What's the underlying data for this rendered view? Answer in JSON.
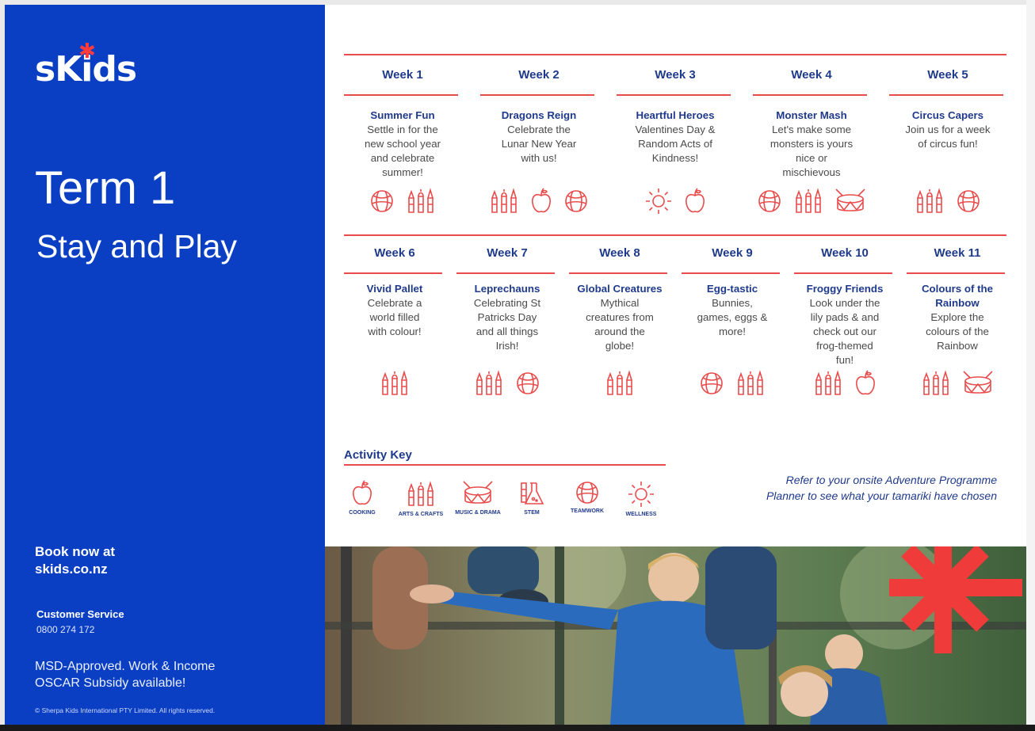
{
  "sidebar": {
    "logo": "sKids",
    "term_title": "Term 1",
    "term_subtitle": "Stay and Play",
    "book_line1": "Book now at",
    "book_line2": "skids.co.nz",
    "customer_service_title": "Customer Service",
    "customer_service_phone": "0800 274 172",
    "msd_line1": "MSD-Approved. Work & Income",
    "msd_line2": "OSCAR Subsidy available!",
    "copyright": "© Sherpa Kids International PTY Limited. All rights reserved."
  },
  "weeks": [
    {
      "label": "Week 1",
      "theme": "Summer Fun",
      "desc": [
        "Settle in for the",
        "new school year",
        "and celebrate",
        "summer!"
      ],
      "icons": [
        "teamwork",
        "arts"
      ]
    },
    {
      "label": "Week 2",
      "theme": "Dragons Reign",
      "desc": [
        "Celebrate the",
        "Lunar New Year",
        "with us!"
      ],
      "icons": [
        "arts",
        "cooking",
        "teamwork"
      ]
    },
    {
      "label": "Week 3",
      "theme": "Heartful Heroes",
      "desc": [
        "Valentines Day &",
        "Random Acts of",
        "Kindness!"
      ],
      "icons": [
        "wellness",
        "cooking"
      ]
    },
    {
      "label": "Week 4",
      "theme": "Monster Mash",
      "desc": [
        "Let's make some",
        "monsters is yours",
        "nice or",
        "mischievous"
      ],
      "icons": [
        "teamwork",
        "arts",
        "music"
      ]
    },
    {
      "label": "Week 5",
      "theme": "Circus Capers",
      "desc": [
        "Join us for a week",
        "of circus fun!"
      ],
      "icons": [
        "arts",
        "teamwork"
      ]
    },
    {
      "label": "Week 6",
      "theme": "Vivid Pallet",
      "desc": [
        "Celebrate a",
        "world filled",
        "with colour!"
      ],
      "icons": [
        "arts"
      ]
    },
    {
      "label": "Week 7",
      "theme": "Leprechauns",
      "desc": [
        "Celebrating St",
        "Patricks Day",
        "and all things",
        "Irish!"
      ],
      "icons": [
        "arts",
        "teamwork"
      ]
    },
    {
      "label": "Week 8",
      "theme": "Global Creatures",
      "desc": [
        "Mythical",
        "creatures from",
        "around the",
        "globe!"
      ],
      "icons": [
        "arts"
      ]
    },
    {
      "label": "Week 9",
      "theme": "Egg-tastic",
      "desc": [
        "Bunnies,",
        "games, eggs &",
        "more!"
      ],
      "icons": [
        "teamwork",
        "arts"
      ]
    },
    {
      "label": "Week 10",
      "theme": "Froggy Friends",
      "desc": [
        "Look under the",
        "lily pads & and",
        "check out our",
        "frog-themed",
        "fun!"
      ],
      "icons": [
        "arts",
        "cooking"
      ]
    },
    {
      "label": "Week 11",
      "theme": "Colours of the Rainbow",
      "desc": [
        "Explore the",
        "colours of the",
        "Rainbow"
      ],
      "icons": [
        "arts",
        "music"
      ]
    }
  ],
  "activity_key": {
    "title": "Activity Key",
    "items": [
      {
        "icon": "cooking",
        "label": "COOKING"
      },
      {
        "icon": "arts",
        "label": "ARTS & CRAFTS"
      },
      {
        "icon": "music",
        "label": "MUSIC & DRAMA"
      },
      {
        "icon": "stem",
        "label": "STEM"
      },
      {
        "icon": "teamwork",
        "label": "TEAMWORK"
      },
      {
        "icon": "wellness",
        "label": "WELLNESS"
      }
    ]
  },
  "refer_text_line1": "Refer to your onsite Adventure Programme",
  "refer_text_line2": "Planner to see what your tamariki have chosen",
  "colors": {
    "brand_blue": "#0a3fc4",
    "accent_red": "#e84c4c",
    "heading_navy": "#1f3a8a"
  }
}
